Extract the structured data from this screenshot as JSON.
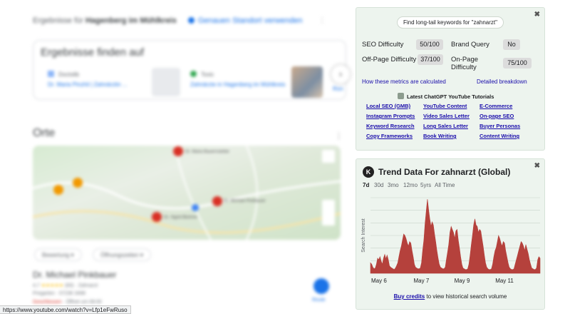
{
  "serp": {
    "location_text": "Ergebnisse für ",
    "location_name": "Hagenberg im Mühlkreis",
    "location_link": "Genauen Standort verwenden",
    "found_title": "Ergebnisse finden auf",
    "found_items": [
      {
        "source": "Doctolib",
        "link": "Dr. Maria Pinzhil | Zahnärztin ..."
      },
      {
        "source": "Toxic",
        "link": "Zahnärzte in Hagenberg im Mühlkreis"
      },
      {
        "source": "",
        "link": "Ron"
      }
    ],
    "orte_title": "Orte",
    "map_labels": [
      "Dr. Maria Bauernstetter",
      "Dr. Michael Pinkbauer",
      "Dr. Sigrid Bluhme"
    ],
    "filters": [
      "Bewertung",
      "Öffnungszeiten"
    ],
    "business_name": "Dr. Michael Pinkbauer",
    "business_rating": "4,7",
    "business_stars": "★★★★★",
    "business_reviews": "(83) · Zahnarzt",
    "business_address": "Pregarten · 07236 3498",
    "business_hours": "Geschlossen",
    "business_hours_extra": " · Öffnet um 08:00",
    "route_label": "Route"
  },
  "status_url": "https://www.youtube.com/watch?v=Lfp1eFwRuso",
  "panel1": {
    "close": "✖",
    "longtail_button": "Find long-tail keywords for \"zahnarzt\"",
    "metrics": [
      {
        "label": "SEO Difficulty",
        "value": "50/100"
      },
      {
        "label": "Brand Query",
        "value": "No"
      },
      {
        "label": "Off-Page Difficulty",
        "value": "37/100"
      },
      {
        "label": "On-Page Difficulty",
        "value": "75/100"
      }
    ],
    "link_calc": "How these metrics are calculated",
    "link_breakdown": "Detailed breakdown",
    "tutorials_title": "Latest ChatGPT YouTube Tutorials",
    "tutorials": [
      "Local SEO (GMB)",
      "YouTube Content",
      "E-Commerce",
      "Instagram Prompts",
      "Video Sales Letter",
      "On-page SEO",
      "Keyword Research",
      "Long Sales Letter",
      "Buyer Personas",
      "Copy Frameworks",
      "Book Writing",
      "Content Writing"
    ]
  },
  "panel2": {
    "close": "✖",
    "logo": "K",
    "title": "Trend Data For zahnarzt (Global)",
    "ranges": [
      "7d",
      "30d",
      "3mo",
      "12mo",
      "5yrs",
      "All Time"
    ],
    "active_range": "7d",
    "buy_link": "Buy credits",
    "buy_text": " to view historical search volume"
  },
  "chart_data": {
    "type": "area",
    "ylabel": "Search Interest",
    "x_ticks": [
      "May 6",
      "May 7",
      "May 9",
      "May 11"
    ],
    "color": "#b5413c",
    "values": [
      14,
      12,
      8,
      6,
      7,
      12,
      20,
      18,
      22,
      16,
      12,
      20,
      25,
      19,
      24,
      18,
      10,
      8,
      7,
      6,
      5,
      7,
      10,
      14,
      22,
      30,
      36,
      44,
      52,
      50,
      46,
      40,
      36,
      42,
      40,
      30,
      22,
      12,
      8,
      7,
      6,
      6,
      7,
      14,
      30,
      44,
      66,
      82,
      98,
      84,
      72,
      62,
      68,
      64,
      52,
      42,
      30,
      20,
      12,
      8,
      7,
      6,
      6,
      8,
      18,
      28,
      38,
      54,
      62,
      58,
      54,
      46,
      56,
      58,
      44,
      34,
      22,
      12,
      7,
      6,
      5,
      5,
      6,
      12,
      24,
      38,
      50,
      64,
      72,
      64,
      62,
      54,
      58,
      56,
      46,
      36,
      24,
      14,
      8,
      6,
      5,
      5,
      6,
      12,
      22,
      30,
      34,
      42,
      50,
      46,
      40,
      36,
      42,
      40,
      30,
      22,
      14,
      8,
      6,
      5,
      5,
      6,
      12,
      18,
      24,
      30,
      36,
      42,
      40,
      36,
      30,
      38,
      32,
      26,
      18,
      12,
      7,
      6,
      5,
      5,
      7,
      18,
      22,
      20
    ]
  }
}
